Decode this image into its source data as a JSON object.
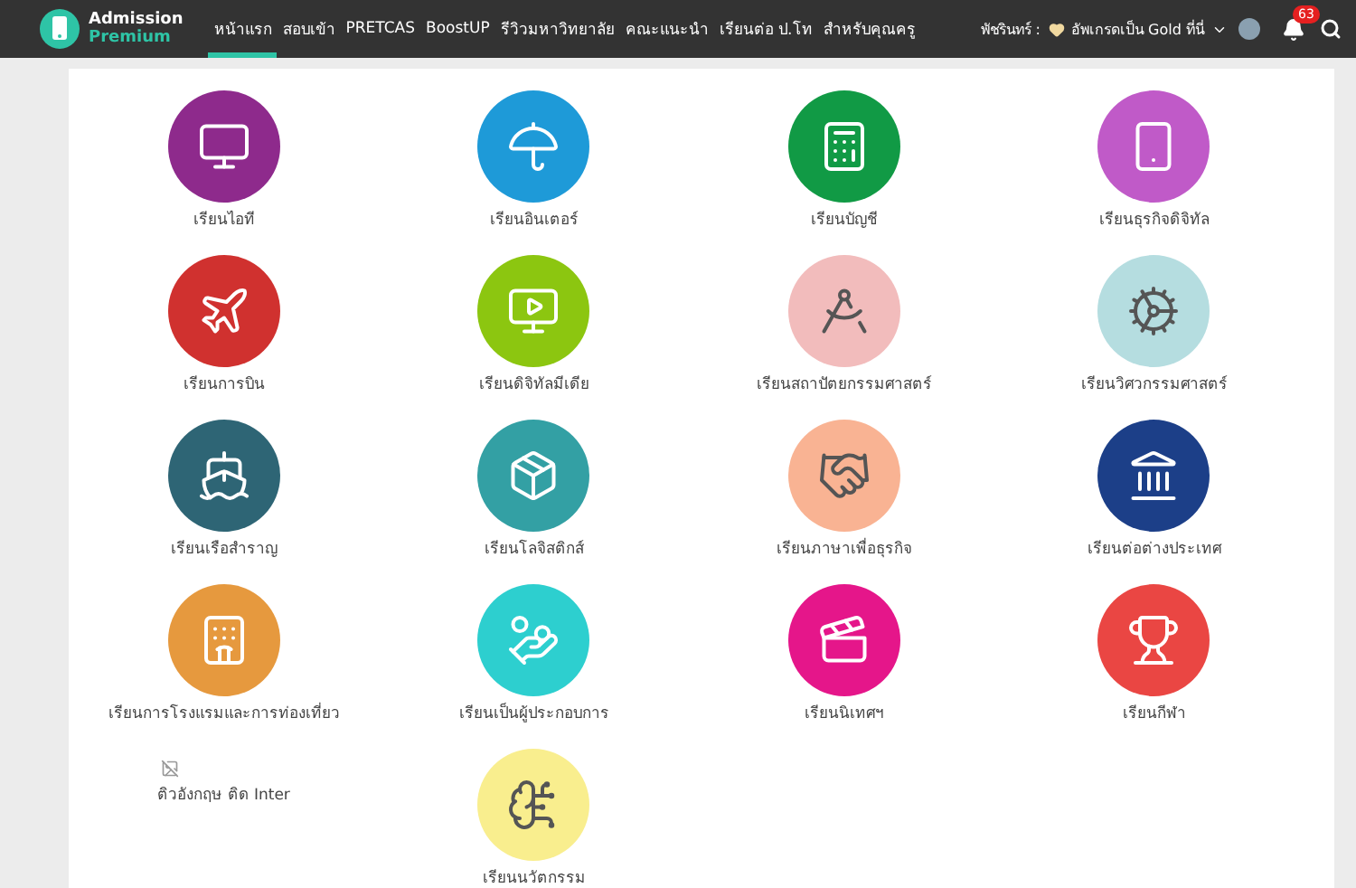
{
  "header": {
    "logo": {
      "line1": "Admission",
      "line2": "Premium"
    },
    "nav": [
      {
        "label": "หน้าแรก",
        "selected": true
      },
      {
        "label": "สอบเข้า",
        "selected": false
      },
      {
        "label": "PRETCAS",
        "selected": false
      },
      {
        "label": "BoostUP",
        "selected": false
      },
      {
        "label": "รีวิวมหาวิทยาลัย",
        "selected": false
      },
      {
        "label": "คณะแนะนำ",
        "selected": false
      },
      {
        "label": "เรียนต่อ ป.โท",
        "selected": false
      },
      {
        "label": "สำหรับคุณครู",
        "selected": false
      }
    ],
    "user": {
      "name": "พัชรินทร์ :",
      "upgrade": "อัพเกรดเป็น Gold ที่นี่"
    },
    "notifications": "63"
  },
  "courses": [
    {
      "label": "เรียนไอที",
      "kind": "monitor",
      "color": "#8e2a8c"
    },
    {
      "label": "เรียนอินเตอร์",
      "kind": "umbrella",
      "color": "#1e9ad8"
    },
    {
      "label": "เรียนบัญชี",
      "kind": "calculator",
      "color": "#119a45"
    },
    {
      "label": "เรียนธุรกิจดิจิทัล",
      "kind": "phone",
      "color": "#c05ac8"
    },
    {
      "label": "เรียนการบิน",
      "kind": "plane",
      "color": "#d0312f"
    },
    {
      "label": "เรียนดิจิทัลมีเดีย",
      "kind": "video",
      "color": "#8cc610"
    },
    {
      "label": "เรียนสถาปัตยกรรมศาสตร์",
      "kind": "compass",
      "color": "#f2bcbc"
    },
    {
      "label": "เรียนวิศวกรรมศาสตร์",
      "kind": "gear",
      "color": "#b5dde0"
    },
    {
      "label": "เรียนเรือสำราญ",
      "kind": "ship",
      "color": "#2e6575"
    },
    {
      "label": "เรียนโลจิสติกส์",
      "kind": "box",
      "color": "#33a0a4"
    },
    {
      "label": "เรียนภาษาเพื่อธุรกิจ",
      "kind": "handshake",
      "color": "#f9b393"
    },
    {
      "label": "เรียนต่อต่างประเทศ",
      "kind": "landmark",
      "color": "#1c3f88"
    },
    {
      "label": "เรียนการโรงแรมและการท่องเที่ยว",
      "kind": "hotel",
      "color": "#e6993e"
    },
    {
      "label": "เรียนเป็นผู้ประกอบการ",
      "kind": "money",
      "color": "#2dcfcf"
    },
    {
      "label": "เรียนนิเทศฯ",
      "kind": "clapper",
      "color": "#e5168a"
    },
    {
      "label": "เรียนกีฬา",
      "kind": "sport",
      "color": "#ea4643"
    },
    {
      "label": "ติวอังกฤษ ติด Inter",
      "kind": "broken"
    },
    {
      "label": "เรียนนวัตกรรม",
      "kind": "brain",
      "color": "#f9ee8e"
    }
  ]
}
